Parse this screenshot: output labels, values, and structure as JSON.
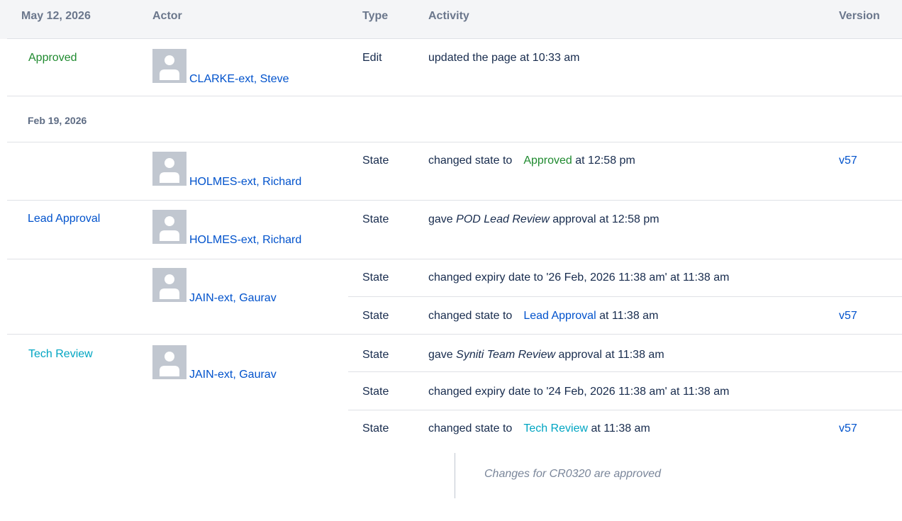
{
  "header": {
    "date": "May 12, 2026",
    "actor": "Actor",
    "type": "Type",
    "activity": "Activity",
    "version": "Version"
  },
  "group1": {
    "state_label": "Approved",
    "actor": "CLARKE-ext, Steve",
    "type": "Edit",
    "activity": "updated the page at 10:33 am"
  },
  "date2": "Feb 19, 2026",
  "group2": {
    "actor": "HOLMES-ext, Richard",
    "type": "State",
    "activity_pre": "changed state to",
    "activity_state": "Approved",
    "activity_post": "at 12:58 pm",
    "version": "v57"
  },
  "group3": {
    "state_label": "Lead Approval",
    "actor": "HOLMES-ext, Richard",
    "type": "State",
    "activity_pre": "gave",
    "activity_em": "POD Lead Review",
    "activity_post": "approval at 12:58 pm"
  },
  "group4": {
    "actor": "JAIN-ext, Gaurav",
    "rows": [
      {
        "type": "State",
        "activity": "changed expiry date to '26 Feb, 2026 11:38 am' at 11:38 am"
      },
      {
        "type": "State",
        "activity_pre": "changed state to",
        "activity_state": "Lead Approval",
        "activity_post": "at 11:38 am",
        "version": "v57"
      }
    ]
  },
  "group5": {
    "state_label": "Tech Review",
    "actor": "JAIN-ext, Gaurav",
    "rows": [
      {
        "type": "State",
        "activity_pre": "gave",
        "activity_em": "Syniti Team Review",
        "activity_post": "approval at 11:38 am"
      },
      {
        "type": "State",
        "activity": "changed expiry date to '24 Feb, 2026 11:38 am' at 11:38 am"
      },
      {
        "type": "State",
        "activity_pre": "changed state to",
        "activity_state": "Tech Review",
        "activity_post": "at 11:38 am",
        "version": "v57"
      }
    ],
    "comment": "Changes for CR0320 are approved"
  },
  "colors": {
    "approved": "#1f8a2f",
    "lead_approval": "#0052cc",
    "tech_review": "#00a5c2",
    "link": "#0052cc",
    "header_bg": "#f4f5f7"
  },
  "icons": {
    "avatar": "default-user-avatar-icon"
  }
}
